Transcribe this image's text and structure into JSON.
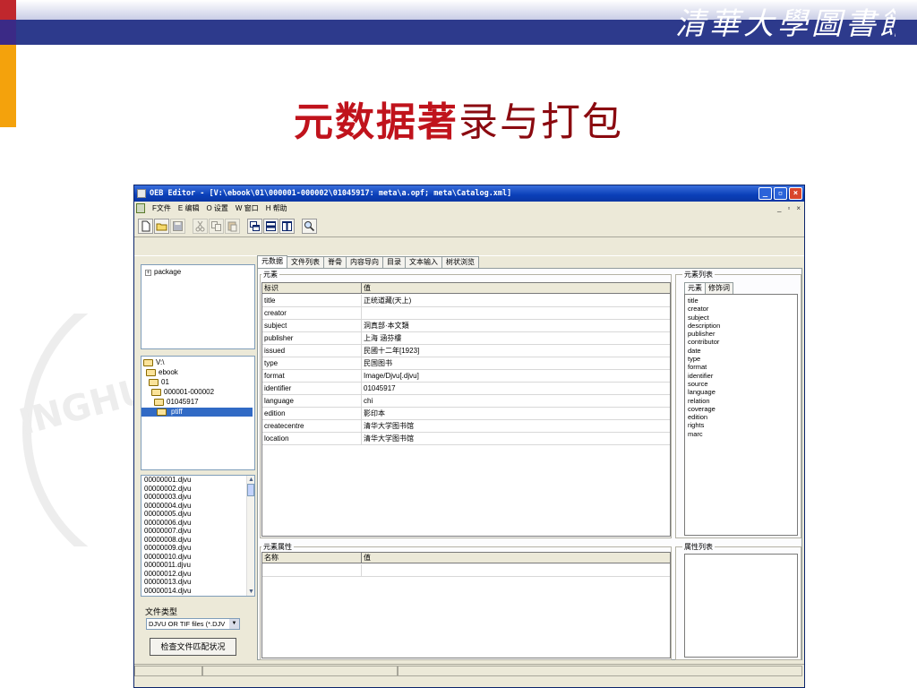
{
  "slide": {
    "title_bold": "元数据著",
    "title_rest": "录与打包",
    "logo_text": "清華大學圖書館",
    "watermark_text": "INGHUA"
  },
  "app": {
    "title": "OEB Editor - [V:\\ebook\\01\\000001-000002\\01045917: meta\\a.opf; meta\\Catalog.xml]",
    "window_buttons": [
      "_",
      "▫",
      "×"
    ],
    "mdi_buttons": [
      "_",
      "▫",
      "×"
    ],
    "menu": [
      {
        "label": "F文件"
      },
      {
        "label": "E 编辑"
      },
      {
        "label": "O 设置"
      },
      {
        "label": "W 窗口"
      },
      {
        "label": "H 帮助"
      }
    ],
    "toolbar": [
      "new-icon",
      "open-icon",
      "save-icon",
      "cut-icon",
      "copy-icon",
      "paste-icon",
      "cascade-icon",
      "tile-horizontal-icon",
      "tile-vertical-icon",
      "search-icon"
    ]
  },
  "left": {
    "package_label": "package",
    "package_expander": "+",
    "tree": [
      {
        "label": "V:\\"
      },
      {
        "label": "ebook"
      },
      {
        "label": "01"
      },
      {
        "label": "000001-000002"
      },
      {
        "label": "01045917"
      },
      {
        "label": "ptiff",
        "selected": true
      }
    ],
    "files": [
      "00000001.djvu",
      "00000002.djvu",
      "00000003.djvu",
      "00000004.djvu",
      "00000005.djvu",
      "00000006.djvu",
      "00000007.djvu",
      "00000008.djvu",
      "00000009.djvu",
      "00000010.djvu",
      "00000011.djvu",
      "00000012.djvu",
      "00000013.djvu",
      "00000014.djvu"
    ],
    "filetype_label": "文件类型",
    "filetype_value": "DJVU OR TIF files (*.DJV",
    "check_button": "检查文件匹配状况"
  },
  "tabs": [
    "元数据",
    "文件列表",
    "脊骨",
    "内容导向",
    "目录",
    "文本输入",
    "树状浏览"
  ],
  "elements": {
    "group_label": "元素",
    "columns": [
      "标识",
      "值"
    ],
    "rows": [
      {
        "id": "title",
        "value": "正统道藏(天上)"
      },
      {
        "id": "creator",
        "value": ""
      },
      {
        "id": "subject",
        "value": "洞真部·本文類"
      },
      {
        "id": "publisher",
        "value": "上海 涵芬樓"
      },
      {
        "id": "issued",
        "value": "民國十二年[1923]"
      },
      {
        "id": "type",
        "value": "民国图书"
      },
      {
        "id": "format",
        "value": "Image/Djvu[.djvu]"
      },
      {
        "id": "identifier",
        "value": "01045917"
      },
      {
        "id": "language",
        "value": "chi"
      },
      {
        "id": "edition",
        "value": "影印本"
      },
      {
        "id": "createcentre",
        "value": "清华大学图书馆"
      },
      {
        "id": "location",
        "value": "清华大学图书馆"
      }
    ]
  },
  "attributes": {
    "group_label": "元素属性",
    "columns": [
      "名称",
      "值"
    ]
  },
  "element_list": {
    "group_label": "元素列表",
    "subtabs": [
      "元素",
      "修饰词"
    ],
    "items": [
      "title",
      "creator",
      "subject",
      "description",
      "publisher",
      "contributor",
      "date",
      "type",
      "format",
      "identifier",
      "source",
      "language",
      "relation",
      "coverage",
      "edition",
      "rights",
      "marc"
    ]
  },
  "attribute_list": {
    "group_label": "属性列表"
  }
}
